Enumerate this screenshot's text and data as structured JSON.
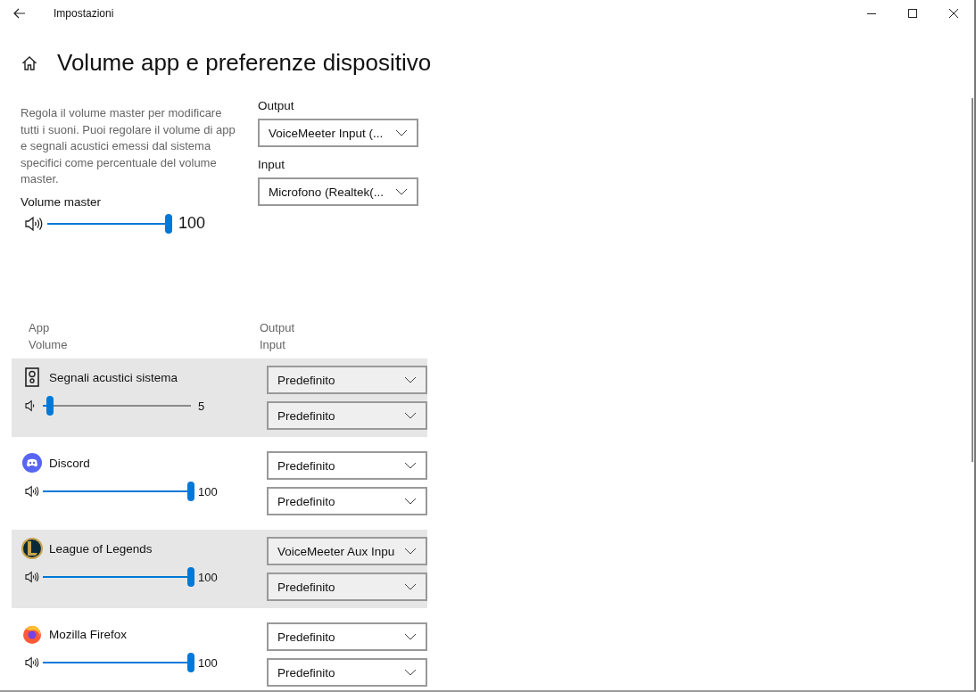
{
  "window": {
    "title": "Impostazioni"
  },
  "page_title": "Volume app e preferenze dispositivo",
  "description": "Regola il volume master per modificare tutti i suoni. Puoi regolare il volume di app e segnali acustici emessi dal sistema specifici come percentuale del volume master.",
  "master": {
    "label": "Volume master",
    "level": 1.0,
    "reading": "100"
  },
  "output": {
    "label": "Output",
    "value": "VoiceMeeter Input (..."
  },
  "input": {
    "label": "Input",
    "value": "Microfono (Realtek(..."
  },
  "columns": {
    "left": [
      "App",
      "Volume"
    ],
    "right": [
      "Output",
      "Input"
    ]
  },
  "apps": [
    {
      "name": "Segnali acustici sistema",
      "level": 0.05,
      "reading": "5",
      "output": "Predefinito",
      "input": "Predefinito",
      "selected": true
    },
    {
      "name": "Discord",
      "level": 1.0,
      "reading": "100",
      "output": "Predefinito",
      "input": "Predefinito",
      "selected": false
    },
    {
      "name": "League of Legends",
      "level": 1.0,
      "reading": "100",
      "output": "VoiceMeeter Aux Inpu",
      "input": "Predefinito",
      "selected": true
    },
    {
      "name": "Mozilla Firefox",
      "level": 1.0,
      "reading": "100",
      "output": "Predefinito",
      "input": "Predefinito",
      "selected": false
    }
  ]
}
